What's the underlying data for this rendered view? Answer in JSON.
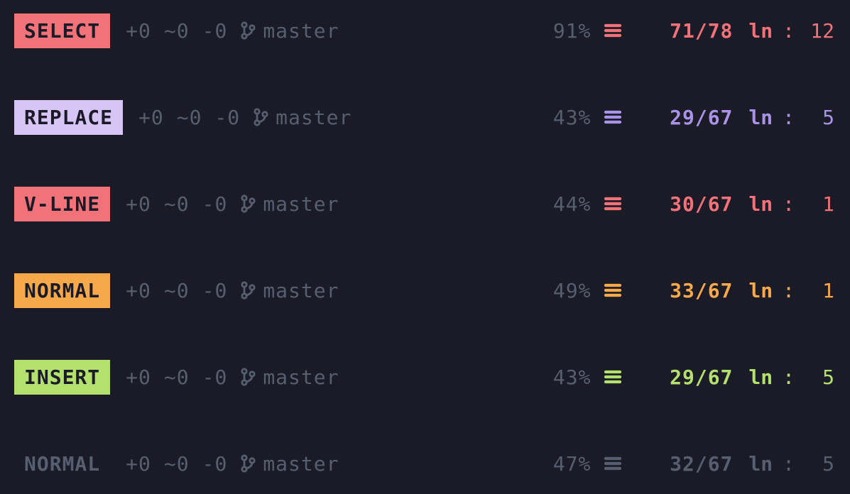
{
  "rows": [
    {
      "mode": "SELECT",
      "mode_bg": "#f27279",
      "accent": "#f27279",
      "plain": false,
      "git_plus": "+0",
      "git_tilde": "~0",
      "git_minus": "-0",
      "branch": "master",
      "percent": "91%",
      "lines": "71/78",
      "ln": "ln",
      "colon": ":",
      "col": "12"
    },
    {
      "mode": "REPLACE",
      "mode_bg": "#d7c5f5",
      "accent": "#a993e8",
      "plain": false,
      "git_plus": "+0",
      "git_tilde": "~0",
      "git_minus": "-0",
      "branch": "master",
      "percent": "43%",
      "lines": "29/67",
      "ln": "ln",
      "colon": ":",
      "col": "5"
    },
    {
      "mode": "V-LINE",
      "mode_bg": "#f27279",
      "accent": "#f27279",
      "plain": false,
      "git_plus": "+0",
      "git_tilde": "~0",
      "git_minus": "-0",
      "branch": "master",
      "percent": "44%",
      "lines": "30/67",
      "ln": "ln",
      "colon": ":",
      "col": "1"
    },
    {
      "mode": "NORMAL",
      "mode_bg": "#f6a94b",
      "accent": "#f6a94b",
      "plain": false,
      "git_plus": "+0",
      "git_tilde": "~0",
      "git_minus": "-0",
      "branch": "master",
      "percent": "49%",
      "lines": "33/67",
      "ln": "ln",
      "colon": ":",
      "col": "1"
    },
    {
      "mode": "INSERT",
      "mode_bg": "#b4e16e",
      "accent": "#b4e16e",
      "plain": false,
      "git_plus": "+0",
      "git_tilde": "~0",
      "git_minus": "-0",
      "branch": "master",
      "percent": "43%",
      "lines": "29/67",
      "ln": "ln",
      "colon": ":",
      "col": "5"
    },
    {
      "mode": "NORMAL",
      "mode_bg": "",
      "accent": "#565f70",
      "plain": true,
      "git_plus": "+0",
      "git_tilde": "~0",
      "git_minus": "-0",
      "branch": "master",
      "percent": "47%",
      "lines": "32/67",
      "ln": "ln",
      "colon": ":",
      "col": "5"
    }
  ]
}
